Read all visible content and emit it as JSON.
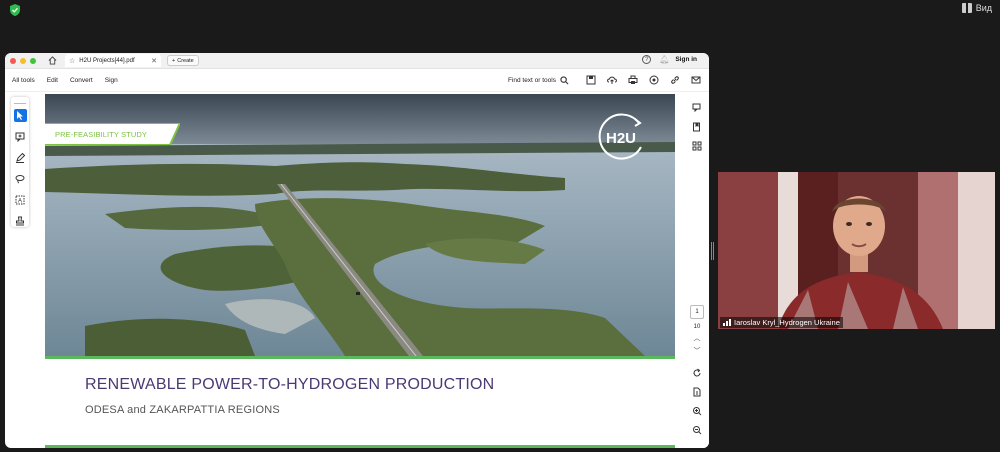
{
  "zoom": {
    "view_label": "Вид",
    "colors": {
      "shield": "#2dbd4e",
      "background": "#1a1a1a"
    }
  },
  "browser": {
    "tab_title": "H2U Projects[44].pdf",
    "create_label": "Create",
    "signin_label": "Sign in"
  },
  "toolbar": {
    "all_tools": "All tools",
    "edit": "Edit",
    "convert": "Convert",
    "sign": "Sign",
    "find_label": "Find text or tools"
  },
  "document": {
    "badge": "PRE-FEASIBILITY STUDY",
    "logo_text": "H2U",
    "title": "RENEWABLE POWER-TO-HYDROGEN PRODUCTION",
    "subtitle": "ODESA and ZAKARPATTIA REGIONS",
    "colors": {
      "accent_green": "#5cb85c",
      "title_purple": "#4a3a73",
      "badge_green": "#7dc242"
    }
  },
  "navigation": {
    "current_page": "1",
    "total_pages": "10"
  },
  "video": {
    "participant_name": "Iaroslav Kryl_Hydrogen Ukraine"
  }
}
